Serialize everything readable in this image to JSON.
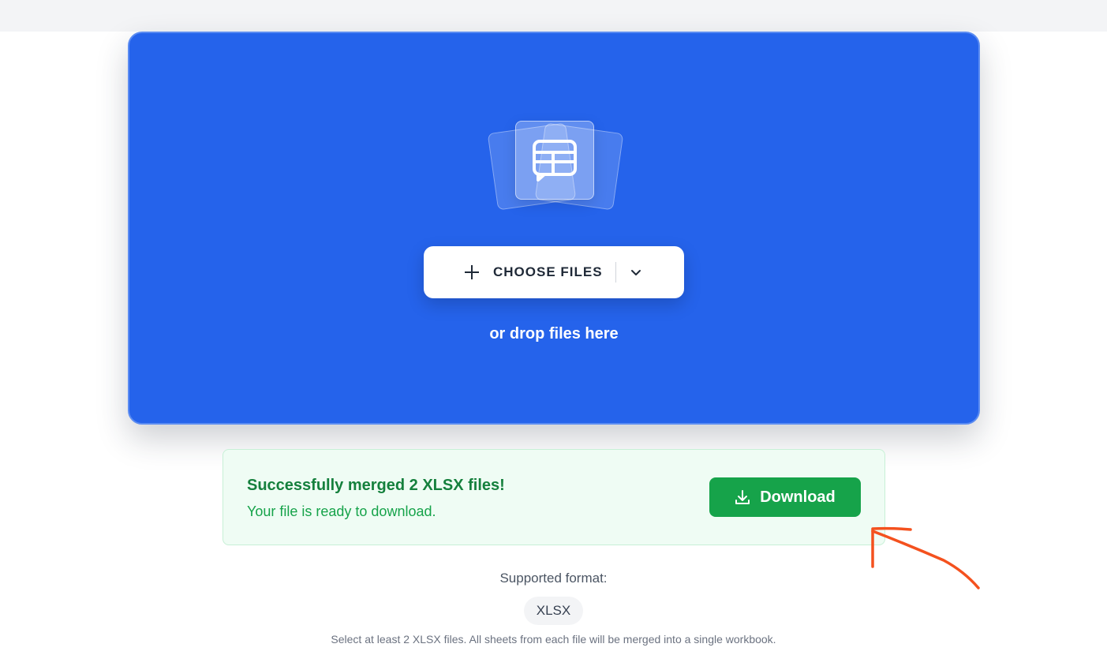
{
  "uploader": {
    "choose_label": "CHOOSE FILES",
    "drop_text": "or drop files here",
    "accent_color": "#2563eb"
  },
  "result": {
    "title": "Successfully merged 2 XLSX files!",
    "subtitle": "Your file is ready to download.",
    "download_label": "Download",
    "success_color": "#16a34a"
  },
  "formats": {
    "label": "Supported format:",
    "items": [
      "XLSX"
    ],
    "help": "Select at least 2 XLSX files. All sheets from each file will be merged into a single workbook."
  },
  "annotation": {
    "type": "hand-drawn-arrow",
    "color": "#f4511e",
    "points_to": "download-button"
  }
}
